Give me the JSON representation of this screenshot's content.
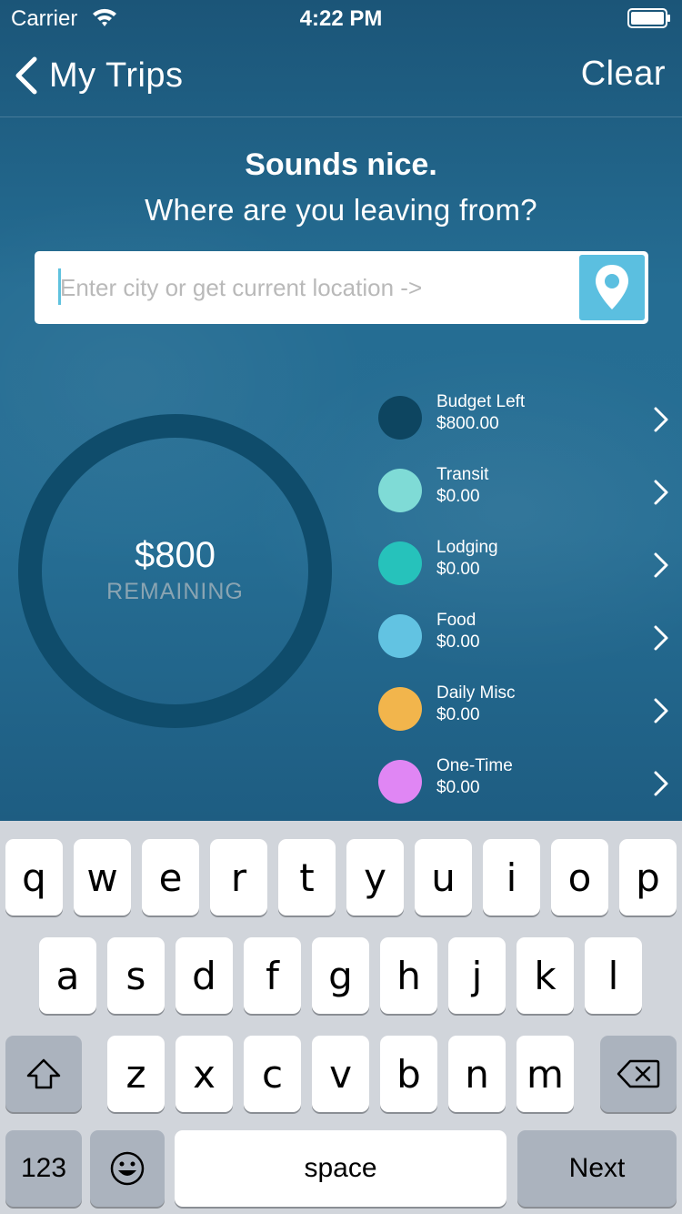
{
  "status_bar": {
    "carrier": "Carrier",
    "time": "4:22 PM"
  },
  "nav": {
    "back_label": "My Trips",
    "clear_label": "Clear"
  },
  "prompt": {
    "headline": "Sounds nice.",
    "question": "Where are you leaving from?"
  },
  "search": {
    "placeholder": "Enter city or get current location ->",
    "value": ""
  },
  "budget": {
    "amount": "$800",
    "label": "REMAINING",
    "remaining_fraction": 1.0
  },
  "legend": [
    {
      "name": "Budget Left",
      "value": "$800.00",
      "color": "#0d4560"
    },
    {
      "name": "Transit",
      "value": "$0.00",
      "color": "#7fdbd6"
    },
    {
      "name": "Lodging",
      "value": "$0.00",
      "color": "#26c2bb"
    },
    {
      "name": "Food",
      "value": "$0.00",
      "color": "#62c3e2"
    },
    {
      "name": "Daily Misc",
      "value": "$0.00",
      "color": "#f2b54c"
    },
    {
      "name": "One-Time",
      "value": "$0.00",
      "color": "#e086f4"
    }
  ],
  "keyboard": {
    "row1": [
      "q",
      "w",
      "e",
      "r",
      "t",
      "y",
      "u",
      "i",
      "o",
      "p"
    ],
    "row2": [
      "a",
      "s",
      "d",
      "f",
      "g",
      "h",
      "j",
      "k",
      "l"
    ],
    "row3": [
      "z",
      "x",
      "c",
      "v",
      "b",
      "n",
      "m"
    ],
    "numbers_label": "123",
    "space_label": "space",
    "next_label": "Next"
  },
  "colors": {
    "donut_ring": "#0f4c6b",
    "accent": "#5bbfe0"
  }
}
